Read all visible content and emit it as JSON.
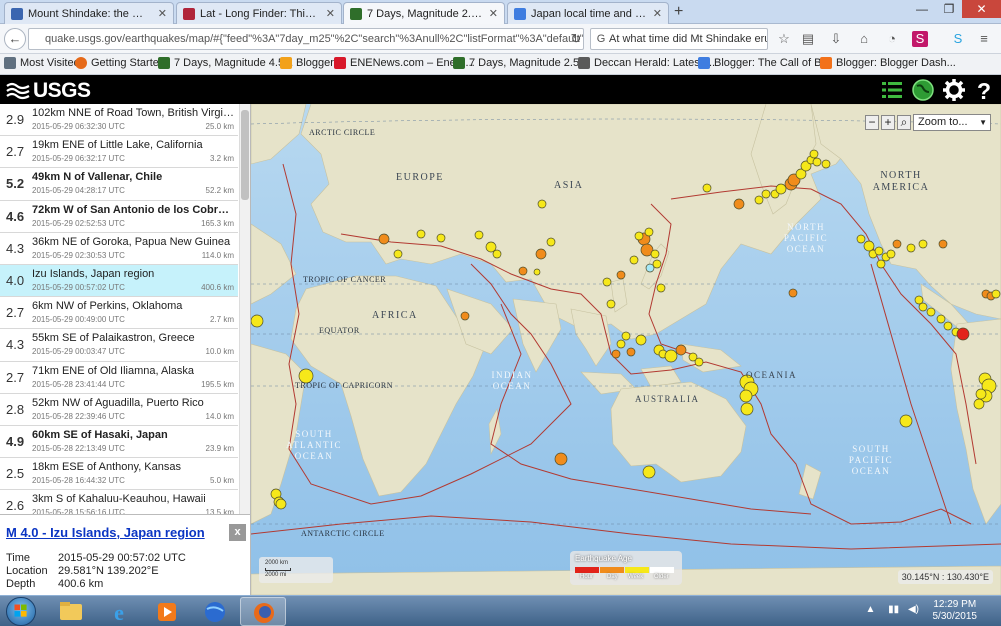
{
  "browser": {
    "tabs": [
      {
        "label": "Mount Shindake: the mom...",
        "icon": "globe-icon",
        "color": "#3b66b0"
      },
      {
        "label": "Lat - Long Finder: This pag...",
        "icon": "uk-flag-icon",
        "color": "#b0253a"
      },
      {
        "label": "7 Days, Magnitude 2.5+ W...",
        "icon": "usgs-icon",
        "color": "#2f6e2a"
      },
      {
        "label": "Japan local time and UTC -...",
        "icon": "google-icon",
        "color": "#3f7de0"
      }
    ],
    "active_tab": 2,
    "url": "quake.usgs.gov/earthquakes/map/#{\"feed\"%3A\"7day_m25\"%2C\"search\"%3Anull%2C\"listFormat\"%3A\"default\"%2C\"sort\"%",
    "search_value": "At what time did Mt Shindake erup",
    "new_tab_symbol": "+",
    "window_buttons": {
      "minimize": "—",
      "maximize": "❐",
      "close": "✕"
    }
  },
  "bookmarks": [
    {
      "label": "Most Visited",
      "color": "#607080"
    },
    {
      "label": "Getting Started",
      "color": "#e66a1a"
    },
    {
      "label": "7 Days, Magnitude 4.5...",
      "color": "#2f6e2a"
    },
    {
      "label": "Blogger",
      "color": "#f2a11a"
    },
    {
      "label": "ENENews.com – Energ...",
      "color": "#d8182a"
    },
    {
      "label": "7 Days, Magnitude 2.5...",
      "color": "#2f6e2a"
    },
    {
      "label": "Deccan Herald: Latest ...",
      "color": "#5a5a5a"
    },
    {
      "label": "Blogger: The Call of B...",
      "color": "#3f7de0"
    },
    {
      "label": "Blogger: Blogger Dash...",
      "color": "#f2711a"
    }
  ],
  "usgs": {
    "logo": "USGS"
  },
  "quakes": [
    {
      "mag": "2.9",
      "place": "102km NNE of Road Town, British Virgin I...",
      "time": "2015-05-29 06:32:30 UTC",
      "depth": "25.0 km",
      "bold": false
    },
    {
      "mag": "2.7",
      "place": "19km ENE of Little Lake, California",
      "time": "2015-05-29 06:32:17 UTC",
      "depth": "3.2 km",
      "bold": false
    },
    {
      "mag": "5.2",
      "place": "49km N of Vallenar, Chile",
      "time": "2015-05-29 04:28:17 UTC",
      "depth": "52.2 km",
      "bold": true
    },
    {
      "mag": "4.6",
      "place": "72km W of San Antonio de los Cobres,...",
      "time": "2015-05-29 02:52:53 UTC",
      "depth": "165.3 km",
      "bold": true
    },
    {
      "mag": "4.3",
      "place": "36km NE of Goroka, Papua New Guinea",
      "time": "2015-05-29 02:30:53 UTC",
      "depth": "114.0 km",
      "bold": false
    },
    {
      "mag": "4.0",
      "place": "Izu Islands, Japan region",
      "time": "2015-05-29 00:57:02 UTC",
      "depth": "400.6 km",
      "bold": false,
      "selected": true
    },
    {
      "mag": "2.7",
      "place": "6km NW of Perkins, Oklahoma",
      "time": "2015-05-29 00:49:00 UTC",
      "depth": "2.7 km",
      "bold": false
    },
    {
      "mag": "4.3",
      "place": "55km SE of Palaikastron, Greece",
      "time": "2015-05-29 00:03:47 UTC",
      "depth": "10.0 km",
      "bold": false
    },
    {
      "mag": "2.7",
      "place": "71km ENE of Old Iliamna, Alaska",
      "time": "2015-05-28 23:41:44 UTC",
      "depth": "195.5 km",
      "bold": false
    },
    {
      "mag": "2.8",
      "place": "52km NW of Aguadilla, Puerto Rico",
      "time": "2015-05-28 22:39:46 UTC",
      "depth": "14.0 km",
      "bold": false
    },
    {
      "mag": "4.9",
      "place": "60km SE of Hasaki, Japan",
      "time": "2015-05-28 22:13:49 UTC",
      "depth": "23.9 km",
      "bold": true
    },
    {
      "mag": "2.5",
      "place": "18km ESE of Anthony, Kansas",
      "time": "2015-05-28 16:44:32 UTC",
      "depth": "5.0 km",
      "bold": false
    },
    {
      "mag": "2.6",
      "place": "3km S of Kahaluu-Keauhou, Hawaii",
      "time": "2015-05-28 15:56:16 UTC",
      "depth": "13.5 km",
      "bold": false
    }
  ],
  "detail": {
    "title": "M 4.0 - Izu Islands, Japan region",
    "close": "x",
    "time_label": "Time",
    "time_value": "2015-05-29 00:57:02 UTC",
    "location_label": "Location",
    "location_value_1": "29.581°N 139.202°E",
    "depth_label": "Depth",
    "depth_value": "400.6 km"
  },
  "map": {
    "zoom_minus": "−",
    "zoom_plus": "+",
    "zoom_select": "Zoom to...",
    "labels": {
      "arctic": "ARCTIC CIRCLE",
      "europe": "EUROPE",
      "asia": "ASIA",
      "north_america": "NORTH AMERICA",
      "north_pacific": "NORTH PACIFIC OCEAN",
      "tropic_cancer": "TROPIC OF CANCER",
      "africa": "AFRICA",
      "equator": "EQUATOR",
      "indian_ocean": "INDIAN OCEAN",
      "australia": "AUSTRALIA",
      "tropic_capricorn": "TROPIC OF CAPRICORN",
      "south_atlantic": "SOUTH ATLANTIC OCEAN",
      "south_pacific": "SOUTH PACIFIC OCEAN",
      "antarctic": "ANTARCTIC CIRCLE",
      "oceania": "OCEANIA"
    },
    "scale": {
      "km": "2000 km",
      "mi": "2000 mi"
    },
    "legend": {
      "title": "Earthquake Age",
      "items": [
        {
          "label": "Hour",
          "color": "#e2231a"
        },
        {
          "label": "Day",
          "color": "#f08c1c"
        },
        {
          "label": "Week",
          "color": "#f6e81a"
        },
        {
          "label": "Older",
          "color": "#ffffff"
        }
      ]
    },
    "coordinates": "30.145°N : 130.430°E",
    "colors": {
      "ocean": "#a9cfee",
      "land": "#e6e3c9",
      "plate_boundary": "#b23a32",
      "week": "#f6e81a",
      "day": "#f08c1c",
      "hour": "#e2231a",
      "selected": "#a6e8f7"
    }
  },
  "taskbar": {
    "apps": [
      "windows-explorer",
      "internet-explorer",
      "media-player",
      "google-earth",
      "firefox"
    ],
    "time": "12:29 PM",
    "date": "5/30/2015",
    "tray_symbol": "▲"
  }
}
